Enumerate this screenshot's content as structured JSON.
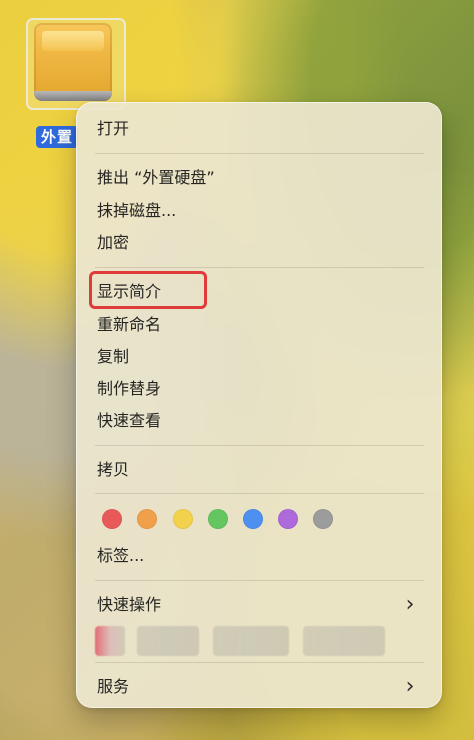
{
  "desktop": {
    "drive_label": "外置"
  },
  "menu": {
    "open": "打开",
    "eject": "推出 “外置硬盘”",
    "erase": "抹掉磁盘...",
    "encrypt": "加密",
    "get_info": "显示简介",
    "rename": "重新命名",
    "duplicate": "复制",
    "make_alias": "制作替身",
    "quick_look": "快速查看",
    "copy": "拷贝",
    "tags_label": "标签...",
    "quick_actions": "快速操作",
    "services": "服务"
  },
  "tag_colors": [
    "#e85a5a",
    "#f0a04a",
    "#f2d24c",
    "#64c660",
    "#4e90ef",
    "#ae69db",
    "#9c9c9c"
  ]
}
